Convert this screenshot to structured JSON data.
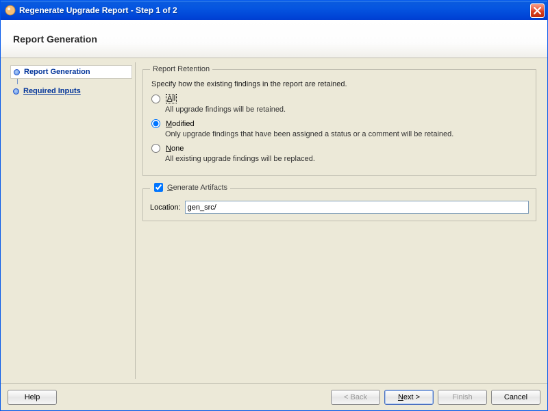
{
  "window": {
    "title": "Regenerate Upgrade Report - Step 1 of 2"
  },
  "header": {
    "title": "Report Generation"
  },
  "nav": {
    "items": [
      {
        "label": "Report Generation",
        "active": true
      },
      {
        "label": "Required Inputs",
        "active": false
      }
    ]
  },
  "retention": {
    "legend": "Report Retention",
    "intro": "Specify how the existing findings in the report are retained.",
    "options": {
      "all": {
        "label": "All",
        "desc": "All upgrade findings will be retained."
      },
      "modified": {
        "label": "Modified",
        "desc": "Only upgrade findings that have been assigned a status or a comment will be retained."
      },
      "none": {
        "label": "None",
        "desc": "All existing upgrade findings will be replaced."
      }
    },
    "selected": "modified"
  },
  "artifacts": {
    "checkbox_label": "Generate Artifacts",
    "checked": true,
    "location_label": "Location:",
    "location_value": "gen_src/"
  },
  "buttons": {
    "help": "Help",
    "back": "< Back",
    "next": "Next >",
    "finish": "Finish",
    "cancel": "Cancel"
  }
}
